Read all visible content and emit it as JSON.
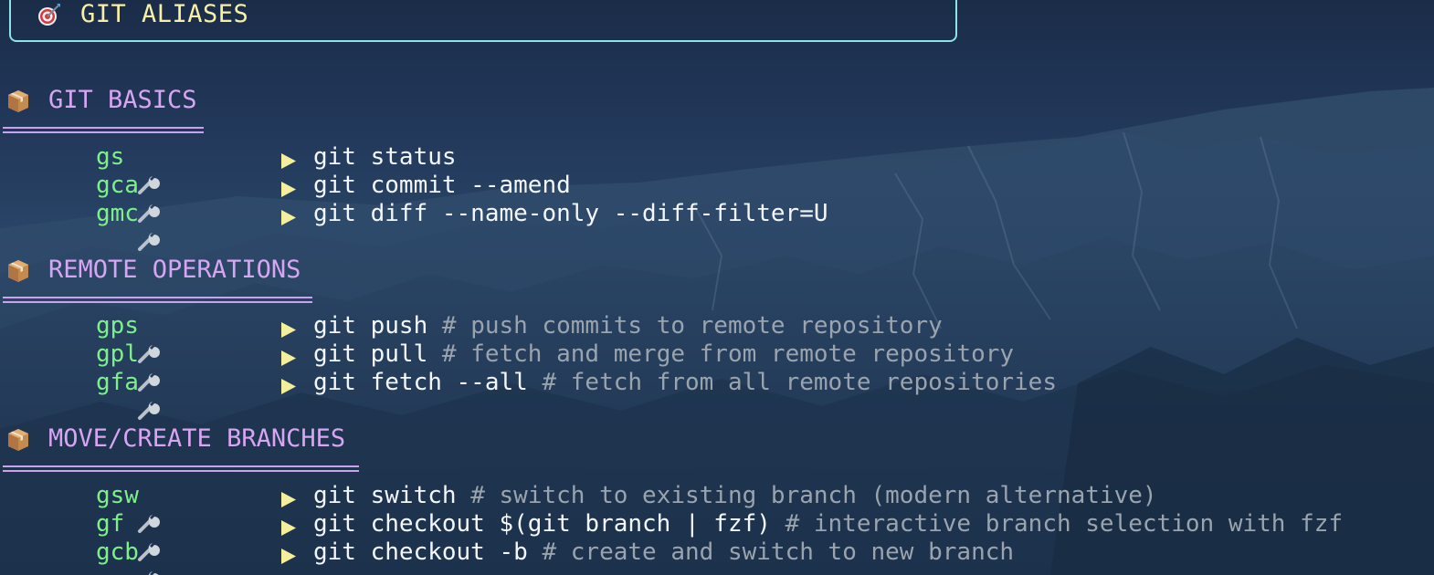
{
  "header": {
    "icon": "target-icon",
    "title": "GIT ALIASES"
  },
  "colors": {
    "header_border": "#8de3ec",
    "header_text": "#f7f0a6",
    "section_text": "#d7a6f2",
    "alias_text": "#7ef08a",
    "arrow": "#f3ef9a",
    "command_text": "#f4f7fa",
    "comment_text": "#9aa4ae"
  },
  "sections": [
    {
      "icon": "package-icon",
      "title": "GIT BASICS",
      "items": [
        {
          "icon": "wrench-icon",
          "alias": "gs",
          "command": "git status",
          "comment": ""
        },
        {
          "icon": "wrench-icon",
          "alias": "gca",
          "command": "git commit --amend",
          "comment": ""
        },
        {
          "icon": "wrench-icon",
          "alias": "gmc",
          "command": "git diff --name-only --diff-filter=U",
          "comment": ""
        }
      ]
    },
    {
      "icon": "package-icon",
      "title": "REMOTE OPERATIONS",
      "items": [
        {
          "icon": "wrench-icon",
          "alias": "gps",
          "command": "git push",
          "comment": "# push commits to remote repository"
        },
        {
          "icon": "wrench-icon",
          "alias": "gpl",
          "command": "git pull",
          "comment": "# fetch and merge from remote repository"
        },
        {
          "icon": "wrench-icon",
          "alias": "gfa",
          "command": "git fetch --all",
          "comment": "# fetch from all remote repositories"
        }
      ]
    },
    {
      "icon": "package-icon",
      "title": "MOVE/CREATE BRANCHES",
      "items": [
        {
          "icon": "wrench-icon",
          "alias": "gsw",
          "command": "git switch",
          "comment": "# switch to existing branch (modern alternative)"
        },
        {
          "icon": "wrench-icon",
          "alias": "gf",
          "command": "git checkout $(git branch | fzf)",
          "comment": "# interactive branch selection with fzf"
        },
        {
          "icon": "wrench-icon",
          "alias": "gcb",
          "command": "git checkout -b",
          "comment": "# create and switch to new branch"
        }
      ]
    }
  ]
}
